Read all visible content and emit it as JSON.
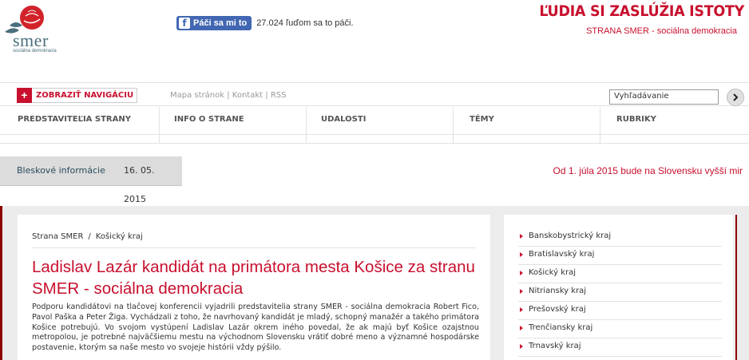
{
  "brand": {
    "logo_text": "smer",
    "logo_subtitle": "sociálna demokracia",
    "slogan": "ĽUDIA SI ZASLÚŽIA ISTOTY",
    "slogan_sub": "STRANA SMER - sociálna demokracia",
    "accent": "#c8102e"
  },
  "facebook": {
    "button_label": "Páči sa mi to",
    "count_text": "27.024 ľuďom sa to páči."
  },
  "topbar": {
    "nav_button_label": "ZOBRAZIŤ NAVIGÁCIU",
    "links": [
      "Mapa stránok",
      "Kontakt",
      "RSS"
    ],
    "search_value": "Vyhľadávanie"
  },
  "mainnav": [
    "PREDSTAVITEĽIA STRANY",
    "INFO O STRANE",
    "UDALOSTI",
    "TÉMY",
    "RUBRIKY"
  ],
  "flash": {
    "label": "Bleskové informácie",
    "date": "16. 05.",
    "year": "2015",
    "headline": "Od 1. júla 2015 bude na Slovensku vyšší mir"
  },
  "article": {
    "breadcrumb": [
      "Strana SMER",
      "Košický kraj"
    ],
    "breadcrumb_sep": "/",
    "title": "Ladislav Lazár kandidát na primátora mesta Košice za stranu SMER - sociálna demokracia",
    "body": "Podporu kandidátovi na tlačovej konferencii vyjadrili predstavitelia strany SMER - sociálna demokracia Robert Fico, Pavol Paška a Peter Žiga. Vychádzali z toho, že navrhovaný kandidát je mladý, schopný manažér a takého primátora Košice potrebujú. Vo svojom vystúpení Ladislav Lazár okrem iného povedal, že ak majú byť Košice ozajstnou metropolou, je potrebné najväčšiemu mestu na východnom Slovensku vrátiť dobré meno a významné hospodárske postavenie, ktorým sa naše mesto vo svojeje histórii vždy pýšilo."
  },
  "regions": [
    "Banskobystrický kraj",
    "Bratislavský kraj",
    "Košický kraj",
    "Nitriansky kraj",
    "Prešovský kraj",
    "Trenčiansky kraj",
    "Trnavský kraj"
  ]
}
